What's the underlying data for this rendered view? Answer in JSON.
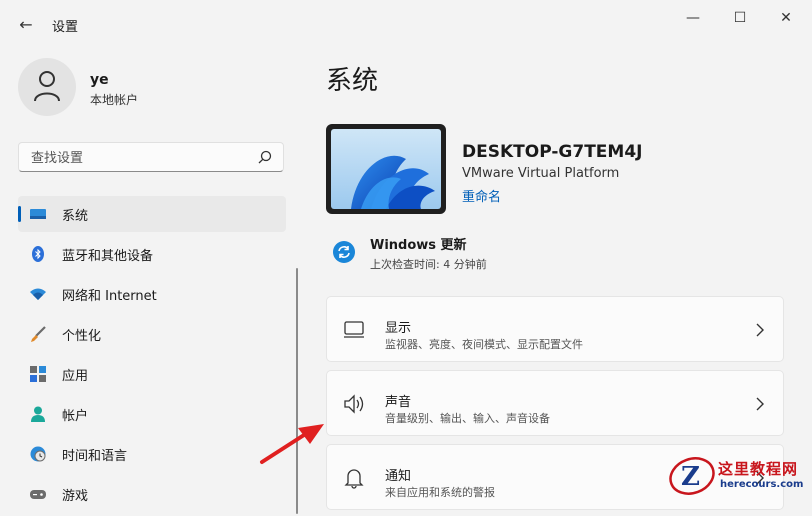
{
  "window": {
    "title": "设置",
    "back_glyph": "←",
    "minimize_glyph": "—",
    "maximize_glyph": "☐",
    "close_glyph": "✕"
  },
  "user": {
    "name": "ye",
    "account_type": "本地帐户"
  },
  "search": {
    "placeholder": "查找设置"
  },
  "sidebar": {
    "items": [
      {
        "label": "系统",
        "icon": "monitor-icon",
        "active": true
      },
      {
        "label": "蓝牙和其他设备",
        "icon": "bluetooth-icon"
      },
      {
        "label": "网络和 Internet",
        "icon": "wifi-icon"
      },
      {
        "label": "个性化",
        "icon": "brush-icon"
      },
      {
        "label": "应用",
        "icon": "apps-icon"
      },
      {
        "label": "帐户",
        "icon": "person-icon"
      },
      {
        "label": "时间和语言",
        "icon": "clock-globe-icon"
      },
      {
        "label": "游戏",
        "icon": "gamepad-icon"
      }
    ]
  },
  "main": {
    "title": "系统",
    "device": {
      "name": "DESKTOP-G7TEM4J",
      "model": "VMware Virtual Platform",
      "rename": "重命名"
    },
    "update": {
      "title": "Windows 更新",
      "subtitle": "上次检查时间: 4 分钟前"
    },
    "cards": [
      {
        "title": "显示",
        "subtitle": "监视器、亮度、夜间模式、显示配置文件",
        "icon": "display-icon"
      },
      {
        "title": "声音",
        "subtitle": "音量级别、输出、输入、声音设备",
        "icon": "speaker-icon"
      },
      {
        "title": "通知",
        "subtitle": "来自应用和系统的警报",
        "icon": "bell-icon"
      }
    ]
  },
  "watermark": {
    "logo_letter": "Z",
    "title": "这里教程网",
    "domain": "herecours.com"
  },
  "colors": {
    "accent": "#005fb8",
    "watermark_red": "#c8161d",
    "watermark_blue": "#1a3c8c"
  }
}
